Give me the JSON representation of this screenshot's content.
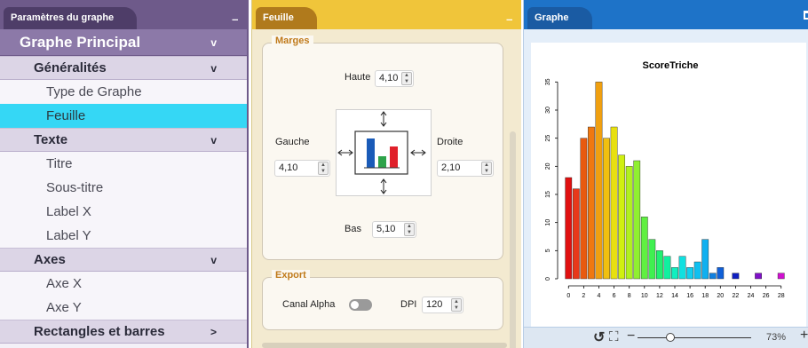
{
  "left_panel": {
    "tab_title": "Paramètres du graphe",
    "minimize": "_",
    "tree": {
      "main": "Graphe Principal",
      "sections": [
        {
          "label": "Généralités",
          "chev": "v",
          "items": [
            "Type de Graphe",
            "Feuille"
          ]
        },
        {
          "label": "Texte",
          "chev": "v",
          "items": [
            "Titre",
            "Sous-titre",
            "Label X",
            "Label Y"
          ]
        },
        {
          "label": "Axes",
          "chev": "v",
          "items": [
            "Axe X",
            "Axe Y"
          ]
        },
        {
          "label": "Rectangles et barres",
          "chev": ">",
          "items": []
        }
      ],
      "main_chev": "v",
      "selected": "Feuille"
    }
  },
  "mid_panel": {
    "tab_title": "Feuille",
    "minimize": "_",
    "margins": {
      "legend": "Marges",
      "haute_label": "Haute",
      "haute_value": "4,10",
      "gauche_label": "Gauche",
      "gauche_value": "4,10",
      "droite_label": "Droite",
      "droite_value": "2,10",
      "bas_label": "Bas",
      "bas_value": "5,10"
    },
    "export": {
      "legend": "Export",
      "alpha_label": "Canal Alpha",
      "dpi_label": "DPI",
      "dpi_value": "120"
    }
  },
  "right_panel": {
    "tab_title": "Graphe",
    "zoom": "73%",
    "zoom_minus": "−",
    "zoom_plus": "+"
  },
  "chart_data": {
    "type": "bar",
    "title": "ScoreTriche",
    "xlabel": "",
    "ylabel": "",
    "x_ticks": [
      "0",
      "2",
      "4",
      "6",
      "8",
      "10",
      "12",
      "14",
      "16",
      "18",
      "20",
      "22",
      "24",
      "26",
      "28"
    ],
    "y_ticks": [
      "0",
      "5",
      "10",
      "15",
      "20",
      "25",
      "30",
      "35"
    ],
    "ylim": [
      0,
      36
    ],
    "x": [
      0,
      1,
      2,
      3,
      4,
      5,
      6,
      7,
      8,
      9,
      10,
      11,
      12,
      13,
      14,
      15,
      16,
      17,
      18,
      19,
      20,
      21,
      22,
      23,
      24,
      25,
      26,
      27,
      28
    ],
    "values": [
      18,
      16,
      25,
      27,
      35,
      25,
      27,
      22,
      20,
      21,
      11,
      7,
      5,
      4,
      2,
      4,
      2,
      3,
      7,
      1,
      2,
      0,
      1,
      0,
      0,
      1,
      0,
      0,
      1
    ],
    "colors": [
      "#e01010",
      "#e8381a",
      "#e85a10",
      "#f07810",
      "#f0a010",
      "#f0c010",
      "#e8e010",
      "#d0f010",
      "#b0f020",
      "#90f030",
      "#60f040",
      "#40f050",
      "#20f070",
      "#10f0a0",
      "#10f0c0",
      "#10e0e0",
      "#10d0f0",
      "#10c0f0",
      "#10b0f0",
      "#1080e0",
      "#1060d8",
      "#1040d0",
      "#1020c0",
      "#3010c0",
      "#5010c0",
      "#8010c8",
      "#a010c8",
      "#c010d0",
      "#d010d0"
    ]
  }
}
